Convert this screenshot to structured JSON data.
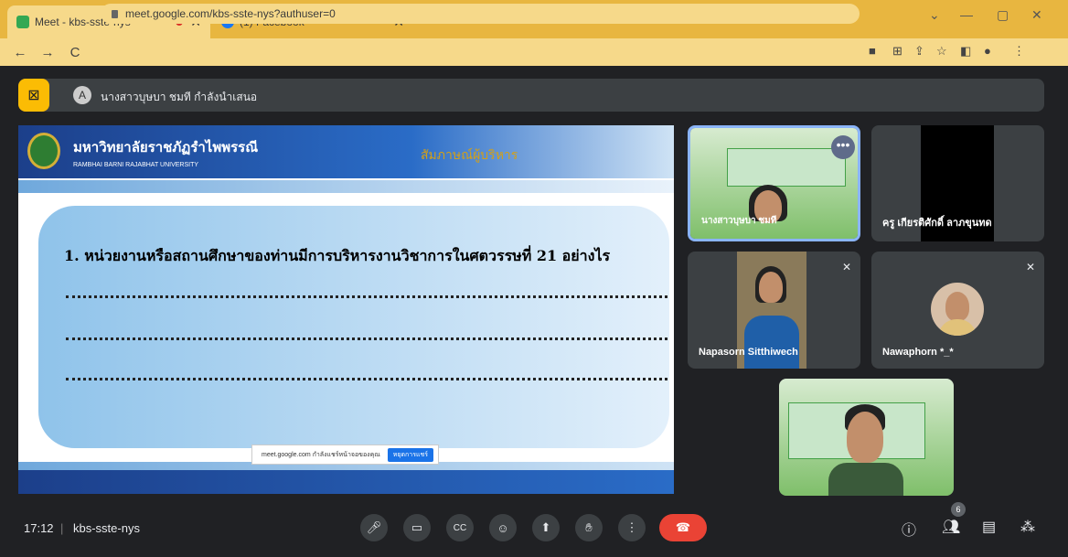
{
  "browser": {
    "tabs": [
      {
        "title": "Meet - kbs-sste-nys",
        "icon": "meet-icon",
        "recording": true
      },
      {
        "title": "(1) Facebook",
        "icon": "facebook-icon"
      }
    ],
    "url": "meet.google.com/kbs-sste-nys?authuser=0"
  },
  "presentation": {
    "presenter_text": "นางสาวบุษบา ชมที กำลังนำเสนอ",
    "avatar_letter": "A"
  },
  "slide": {
    "university_th": "มหาวิทยาลัยราชภัฏรำไพพรรณี",
    "university_en": "RAMBHAI BARNI RAJABHAT UNIVERSITY",
    "header_right": "สัมภาษณ์ผู้บริหาร",
    "question": "1. หน่วยงานหรือสถานศึกษาของท่านมีการบริหารงานวิชาการในศตวรรษที่ 21 อย่างไร",
    "share_note": "meet.google.com กำลังแชร์หน้าจอของคุณ",
    "share_button": "หยุดการแชร์"
  },
  "participants": [
    {
      "name": "นางสาวบุษบา ชมที",
      "active": true
    },
    {
      "name": "ครู เกียรติศักดิ์ ลาภขุนทด",
      "muted": false
    },
    {
      "name": "Napasorn Sitthiwech",
      "muted": true
    },
    {
      "name": "Nawaphorn *_*",
      "muted": true
    },
    {
      "name": "",
      "muted": false
    }
  ],
  "bottom": {
    "time": "17:12",
    "meeting_code": "kbs-sste-nys",
    "people_count": "6"
  },
  "colors": {
    "tabbar": "#e8b640",
    "end_call": "#ea4335",
    "present_icon": "#fbbc04"
  }
}
